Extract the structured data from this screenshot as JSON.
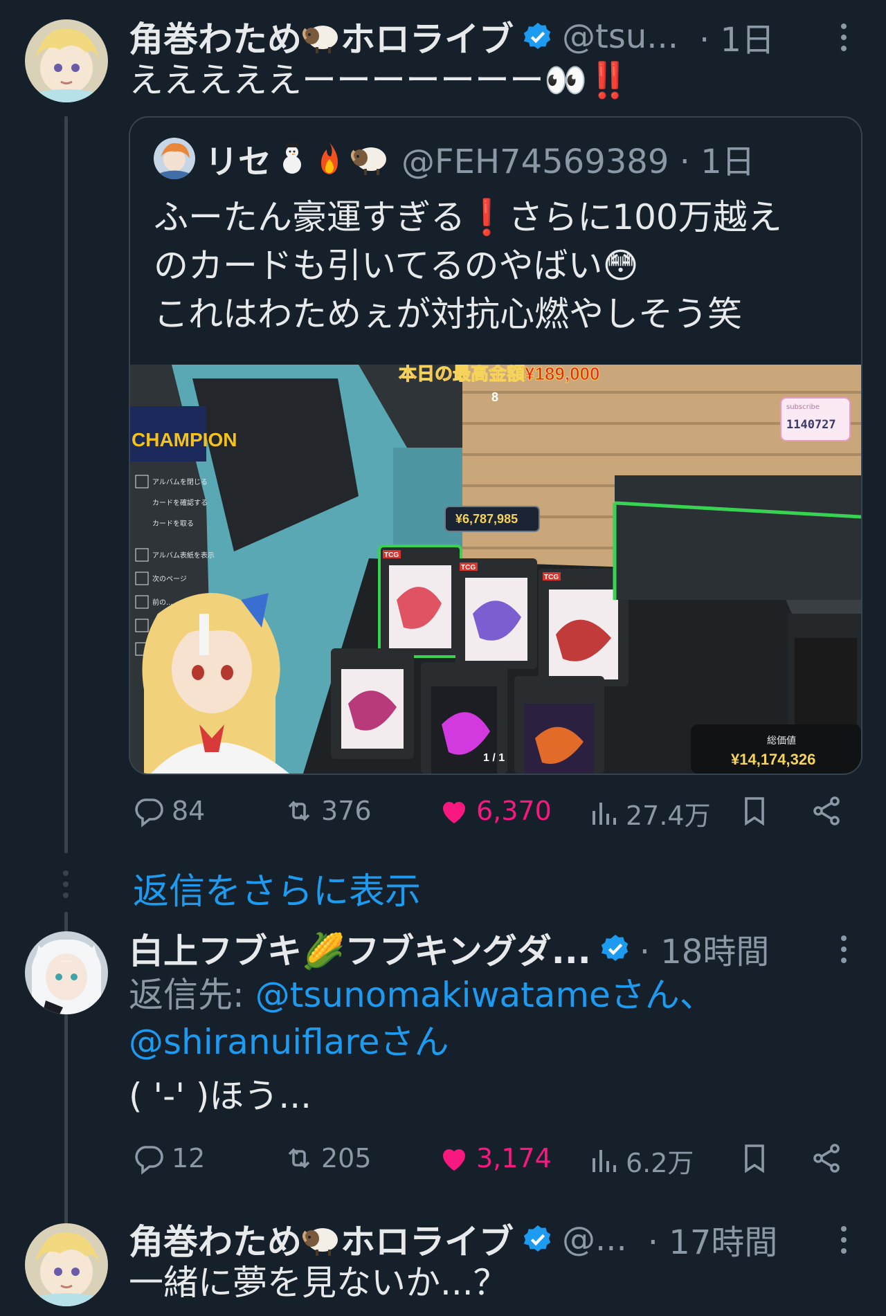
{
  "tweet1": {
    "name": "角巻わため",
    "name_suffix": "ホロライブ",
    "handle": "@tsu...",
    "time": "· 1日",
    "text": "えええええーーーーーーー👀‼️",
    "quote": {
      "name": "リセ",
      "handle": "@FEH74569389 · 1日",
      "lines": [
        "ふーたん豪運すぎる❗さらに100万越え",
        "のカードも引いてるのやばい😳",
        "これはわためぇが対抗心燃やしそう笑"
      ],
      "media": {
        "top_banner": "本日の最高金額¥189,000",
        "banner_sub": "8",
        "subscribe_label": "subscribe",
        "subscriber_count": "1140727",
        "price_tag": "¥6,787,985",
        "total_label": "総価値",
        "total_value": "¥14,174,326",
        "page_indicator": "1 / 1",
        "card_tag": "TCG",
        "sign_text": "CHAMPION",
        "menu_items": [
          "アルバムを閉じる",
          "カードを確認する",
          "カードを取る",
          "アルバム表紙を表示",
          "次のページ",
          "前の...",
          "...",
          "..."
        ]
      }
    },
    "stats": {
      "replies": "84",
      "retweets": "376",
      "likes": "6,370",
      "views": "27.4万"
    }
  },
  "show_more": "返信をさらに表示",
  "tweet2": {
    "name": "白上フブキ🌽フブキングダ...",
    "time": "· 18時間",
    "reply_prefix": "返信先: ",
    "reply_to_1": "@tsunomakiwatameさん、",
    "reply_to_2": "@shiranuiflareさん",
    "text": "( '-' )ほう...",
    "stats": {
      "replies": "12",
      "retweets": "205",
      "likes": "3,174",
      "views": "6.2万"
    }
  },
  "tweet3": {
    "name": "角巻わため",
    "name_suffix": "ホロライブ",
    "handle": "@...",
    "time": "· 17時間",
    "text": "一緒に夢を見ないか...？"
  },
  "colors": {
    "background": "#15202b",
    "accent": "#1d9bf0",
    "like": "#f91880",
    "muted": "#8b98a5"
  },
  "icons": [
    "verified-badge-icon",
    "more-icon",
    "reply-icon",
    "retweet-icon",
    "heart-icon",
    "views-icon",
    "bookmark-icon",
    "share-icon",
    "sheep-emoji-icon",
    "snowman-emoji-icon",
    "fire-emoji-icon",
    "corn-emoji-icon"
  ]
}
